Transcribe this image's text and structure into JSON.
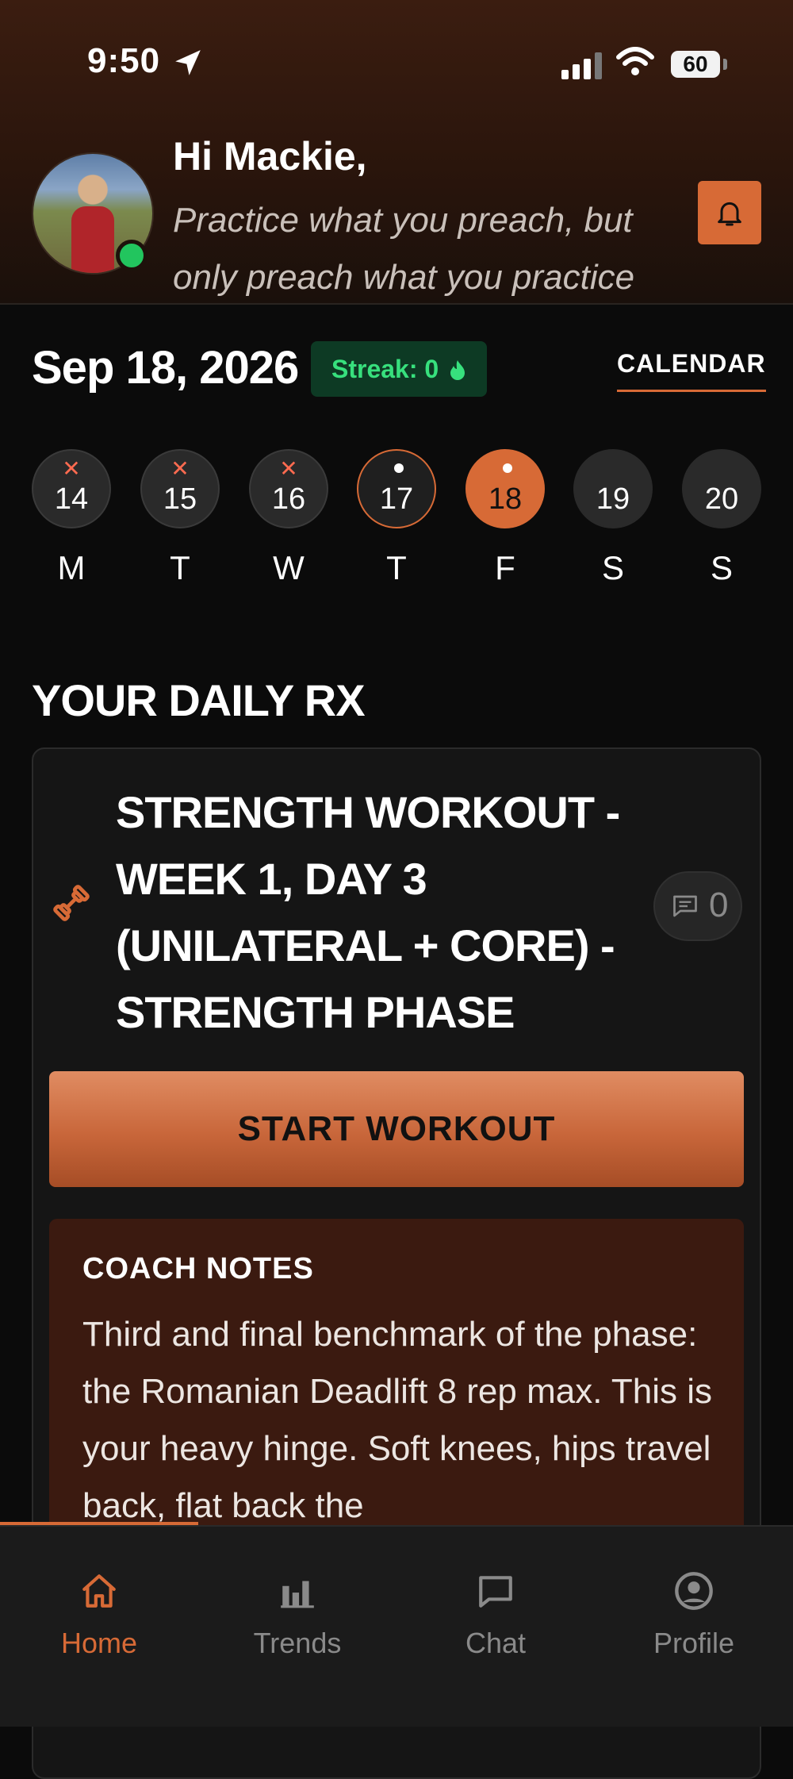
{
  "status_bar": {
    "time": "9:50",
    "battery": "60"
  },
  "header": {
    "greeting": "Hi Mackie,",
    "quote": "Practice what you preach, but only preach what you practice"
  },
  "date_row": {
    "date": "Sep 18, 2026",
    "streak": "Streak: 0",
    "calendar_link": "CALENDAR"
  },
  "week": [
    {
      "num": "14",
      "day": "M",
      "status": "missed"
    },
    {
      "num": "15",
      "day": "T",
      "status": "missed"
    },
    {
      "num": "16",
      "day": "W",
      "status": "missed"
    },
    {
      "num": "17",
      "day": "T",
      "status": "scheduled"
    },
    {
      "num": "18",
      "day": "F",
      "status": "selected"
    },
    {
      "num": "19",
      "day": "S",
      "status": "future"
    },
    {
      "num": "20",
      "day": "S",
      "status": "future"
    }
  ],
  "daily_rx": {
    "section_title": "YOUR DAILY RX",
    "workout_title": "STRENGTH WORKOUT - WEEK 1, DAY 3 (UNILATERAL + CORE) - STRENGTH PHASE",
    "comment_count": "0",
    "start_button": "START WORKOUT",
    "coach_notes_title": "COACH NOTES",
    "coach_notes_body": "Third and final benchmark of the phase: the Romanian Deadlift 8 rep max. This is your heavy hinge. Soft knees, hips travel back, flat back the"
  },
  "tabs": [
    {
      "label": "Home",
      "icon": "home-icon",
      "active": true
    },
    {
      "label": "Trends",
      "icon": "bar-chart-icon",
      "active": false
    },
    {
      "label": "Chat",
      "icon": "chat-icon",
      "active": false
    },
    {
      "label": "Profile",
      "icon": "user-circle-icon",
      "active": false
    }
  ],
  "colors": {
    "accent": "#d76a36",
    "streak": "#37e07d",
    "online": "#22c55e",
    "missed": "#ff6b50"
  }
}
